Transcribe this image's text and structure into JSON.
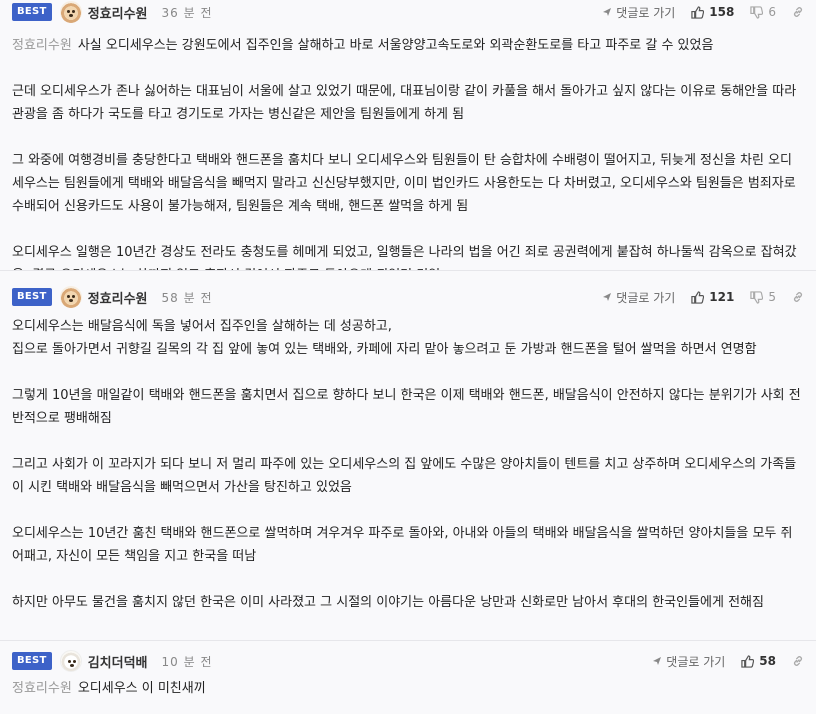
{
  "comments": [
    {
      "badge": "BEST",
      "nickname": "정효리수원",
      "time": "36 분 전",
      "reply_label": "댓글로 가기",
      "likes": "158",
      "dislikes": "6",
      "quote_name": "정효리수원",
      "paragraphs": [
        "사실 오디세우스는 강원도에서 집주인을 살해하고 바로 서울양양고속도로와 외곽순환도로를 타고 파주로 갈 수 있었음",
        "근데 오디세우스가 존나 싫어하는 대표님이 서울에 살고 있었기 때문에, 대표님이랑 같이 카풀을 해서 돌아가고 싶지 않다는 이유로 동해안을 따라 관광을 좀 하다가 국도를 타고 경기도로 가자는 병신같은 제안을 팀원들에게 하게 됨",
        "그 와중에 여행경비를 충당한다고 택배와 핸드폰을 훔치다 보니 오디세우스와 팀원들이 탄 승합차에 수배령이 떨어지고, 뒤늦게 정신을 차린 오디세우스는 팀원들에게 택배와 배달음식을 빼먹지 말라고 신신당부했지만, 이미 법인카드 사용한도는 다 차버렸고, 오디세우스와 팀원들은 범죄자로 수배되어 신용카드도 사용이 불가능해져, 팀원들은 계속 택배, 핸드폰 쌀먹을 하게 됨",
        "오디세우스 일행은 10년간 경상도 전라도 충청도를 헤메게 되었고, 일행들은 나라의 법을 어긴 죄로 공권력에게 붙잡혀 하나둘씩 감옥으로 잡혀갔음. 결국 오디세우스는 차까지 잃고 혼자서 걸어서 파주로 돌아오게 되었던 것임"
      ]
    },
    {
      "badge": "BEST",
      "nickname": "정효리수원",
      "time": "58 분 전",
      "reply_label": "댓글로 가기",
      "likes": "121",
      "dislikes": "5",
      "paragraphs": [
        "오디세우스는 배달음식에 독을 넣어서 집주인을 살해하는 데 성공하고,\n집으로 돌아가면서 귀향길 길목의 각 집 앞에 놓여 있는 택배와, 카페에 자리 맡아 놓으려고 둔 가방과 핸드폰을 털어 쌀먹을 하면서 연명함",
        "그렇게 10년을 매일같이 택배와 핸드폰을 훔치면서 집으로 향하다 보니 한국은 이제 택배와 핸드폰, 배달음식이 안전하지 않다는 분위기가 사회 전반적으로 팽배해짐",
        "그리고 사회가 이 꼬라지가 되다 보니 저 멀리 파주에 있는 오디세우스의 집 앞에도 수많은 양아치들이 텐트를 치고 상주하며 오디세우스의 가족들이 시킨 택배와 배달음식을 빼먹으면서 가산을 탕진하고 있었음",
        "오디세우스는 10년간 훔친 택배와 핸드폰으로 쌀먹하며 겨우겨우 파주로 돌아와, 아내와 아들의 택배와 배달음식을 쌀먹하던 양아치들을 모두 쥐어패고, 자신이 모든 책임을 지고 한국을 떠남",
        "하지만 아무도 물건을 훔치지 않던 한국은 이미 사라졌고 그 시절의 이야기는 아름다운 낭만과 신화로만 남아서 후대의 한국인들에게 전해짐"
      ]
    },
    {
      "badge": "BEST",
      "nickname": "김치더덕배",
      "time": "10 분 전",
      "reply_label": "댓글로 가기",
      "likes": "58",
      "quote_name": "정효리수원",
      "paragraphs": [
        "오디세우스 이 미친새끼"
      ]
    }
  ]
}
